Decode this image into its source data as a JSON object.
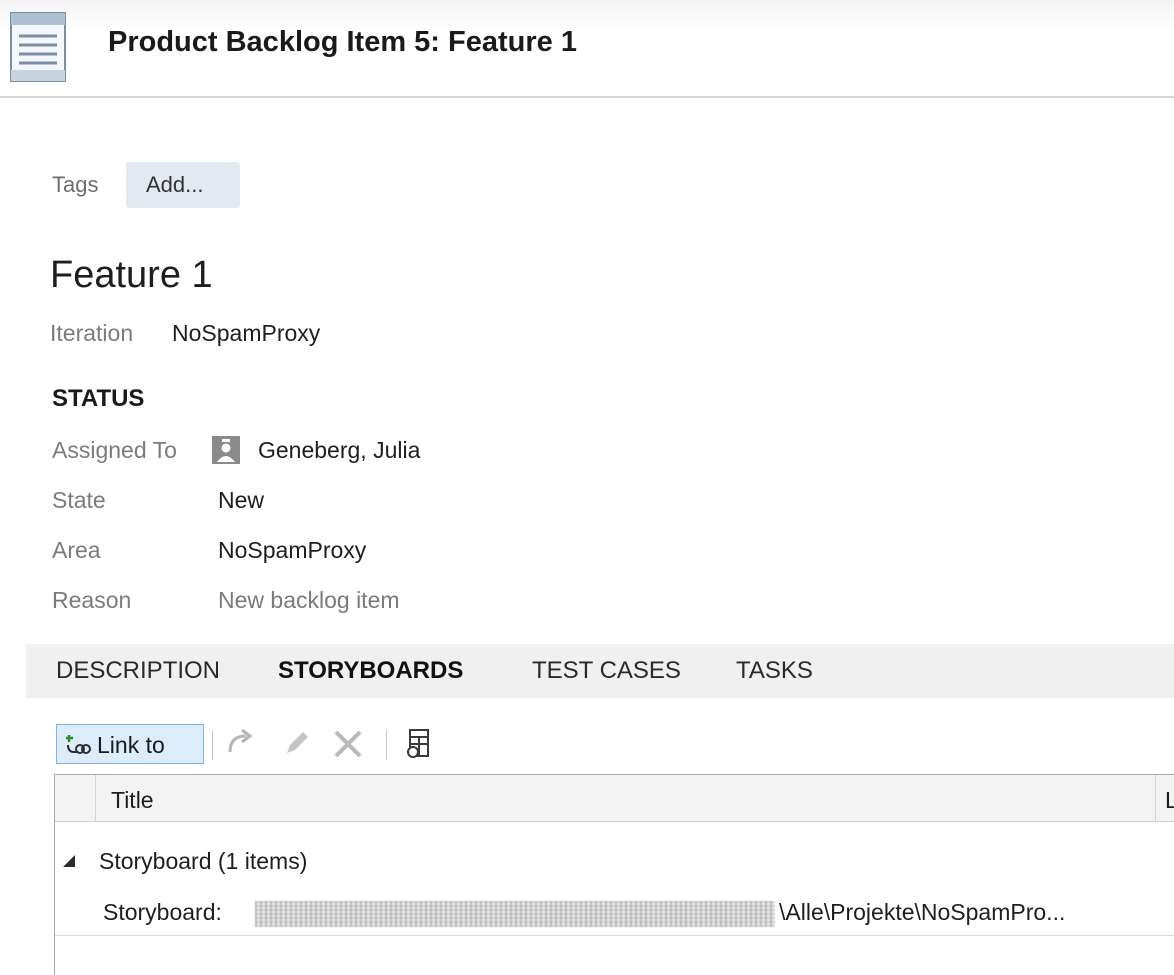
{
  "window": {
    "title": "Product Backlog Item 5: Feature 1"
  },
  "tags": {
    "label": "Tags",
    "add_button": "Add..."
  },
  "item": {
    "title": "Feature 1"
  },
  "iteration": {
    "label": "Iteration",
    "value": "NoSpamProxy"
  },
  "status": {
    "heading": "STATUS",
    "assigned_to": {
      "label": "Assigned To",
      "value": "Geneberg, Julia"
    },
    "state": {
      "label": "State",
      "value": "New"
    },
    "area": {
      "label": "Area",
      "value": "NoSpamProxy"
    },
    "reason": {
      "label": "Reason",
      "value": "New backlog item"
    }
  },
  "tabs": [
    {
      "label": "DESCRIPTION",
      "active": false
    },
    {
      "label": "STORYBOARDS",
      "active": true
    },
    {
      "label": "TEST CASES",
      "active": false
    },
    {
      "label": "TASKS",
      "active": false
    }
  ],
  "toolbar": {
    "link_to": "Link to",
    "icons": [
      "link-to-icon",
      "open-link-icon",
      "edit-icon",
      "delete-icon",
      "column-options-icon"
    ]
  },
  "grid": {
    "columns": [
      "Title",
      "L"
    ],
    "group": {
      "label": "Storyboard (1 items)"
    },
    "rows": [
      {
        "prefix": "Storyboard:",
        "path": "\\Alle\\Projekte\\NoSpamPro..."
      }
    ]
  },
  "colors": {
    "accent_blue": "#dcecfb",
    "accent_border": "#7fb3e3",
    "tab_bar": "#f0f0f0",
    "tag_button": "#e3e9f0"
  }
}
